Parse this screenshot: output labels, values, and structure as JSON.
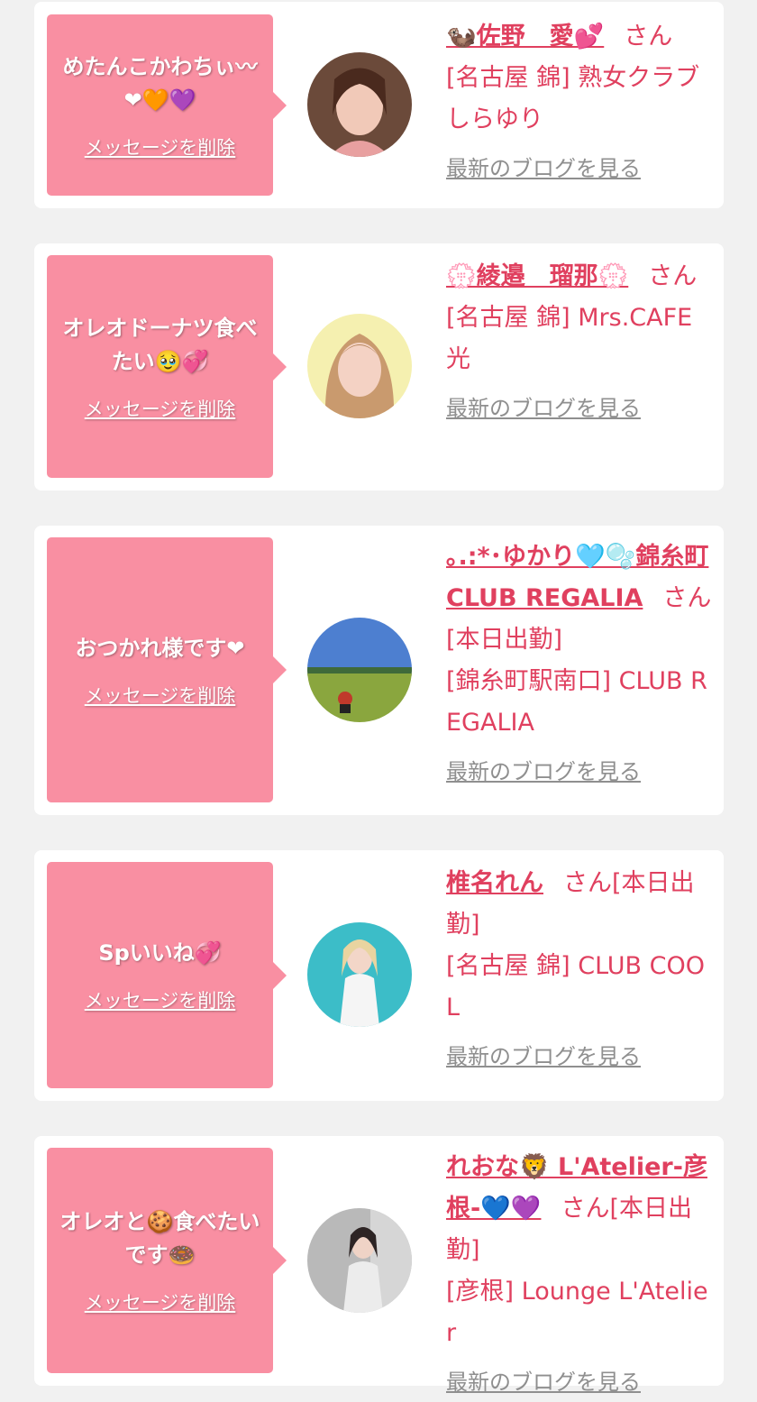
{
  "items": [
    {
      "message": "めたんこかわちぃ〰❤🧡💜",
      "delete_label": "メッセージを削除",
      "name": "🦦佐野　愛💕",
      "honorific": "さん",
      "shop": "[名古屋 錦] 熟女クラブしらゆり",
      "blog_label": "最新のブログを見る"
    },
    {
      "message": "オレオドーナツ食べたい🥹💞",
      "delete_label": "メッセージを削除",
      "name": "💮綾邉　瑠那💮",
      "honorific": "さん",
      "shop": "[名古屋 錦] Mrs.CAFE光",
      "blog_label": "最新のブログを見る"
    },
    {
      "message": "おつかれ様です❤",
      "delete_label": "メッセージを削除",
      "name": "｡.:*･ゆかり🩵🫧錦糸町CLUB REGALIA",
      "honorific": "さん[本日出勤]",
      "shop": "[錦糸町駅南口] CLUB REGALIA",
      "blog_label": "最新のブログを見る"
    },
    {
      "message": "Spいいね💞",
      "delete_label": "メッセージを削除",
      "name": "椎名れん",
      "honorific": "さん[本日出勤]",
      "shop": "[名古屋 錦] CLUB COOL",
      "blog_label": "最新のブログを見る"
    },
    {
      "message": "オレオと🍪食べたいです🍩",
      "delete_label": "メッセージを削除",
      "name": "れおな🦁 L'Atelier-彦根-💙💜",
      "honorific": "さん[本日出勤]",
      "shop": "[彦根] Lounge L'Atelier",
      "blog_label": "最新のブログを見る"
    }
  ],
  "colors": {
    "bubble": "#f98fa2",
    "text_accent": "#e0405f",
    "link_gray": "#8f8f8f",
    "background": "#f1f1f1"
  }
}
